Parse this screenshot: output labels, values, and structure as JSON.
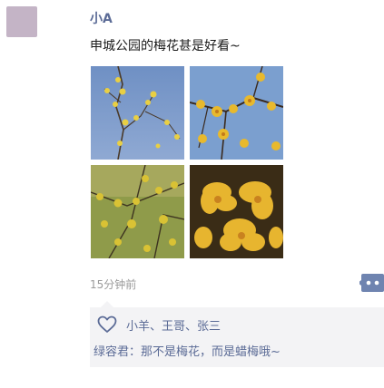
{
  "post": {
    "username": "小A",
    "text": "申城公园的梅花甚是好看~",
    "photos": [
      {
        "description_icon": "wintersweet-photo"
      },
      {
        "description_icon": "wintersweet-photo"
      },
      {
        "description_icon": "wintersweet-photo"
      },
      {
        "description_icon": "wintersweet-photo"
      }
    ],
    "timestamp": "15分钟前",
    "avatar_color": "#c4b4c6"
  },
  "feedback": {
    "likes": "小羊、王哥、张三",
    "comments": [
      {
        "author": "绿容君",
        "separator": "：",
        "text": "那不是梅花，而是蜡梅哦~"
      }
    ]
  },
  "colors": {
    "link": "#5b6b96",
    "background_panel": "#f3f3f5",
    "timestamp": "#9a9a9a"
  }
}
